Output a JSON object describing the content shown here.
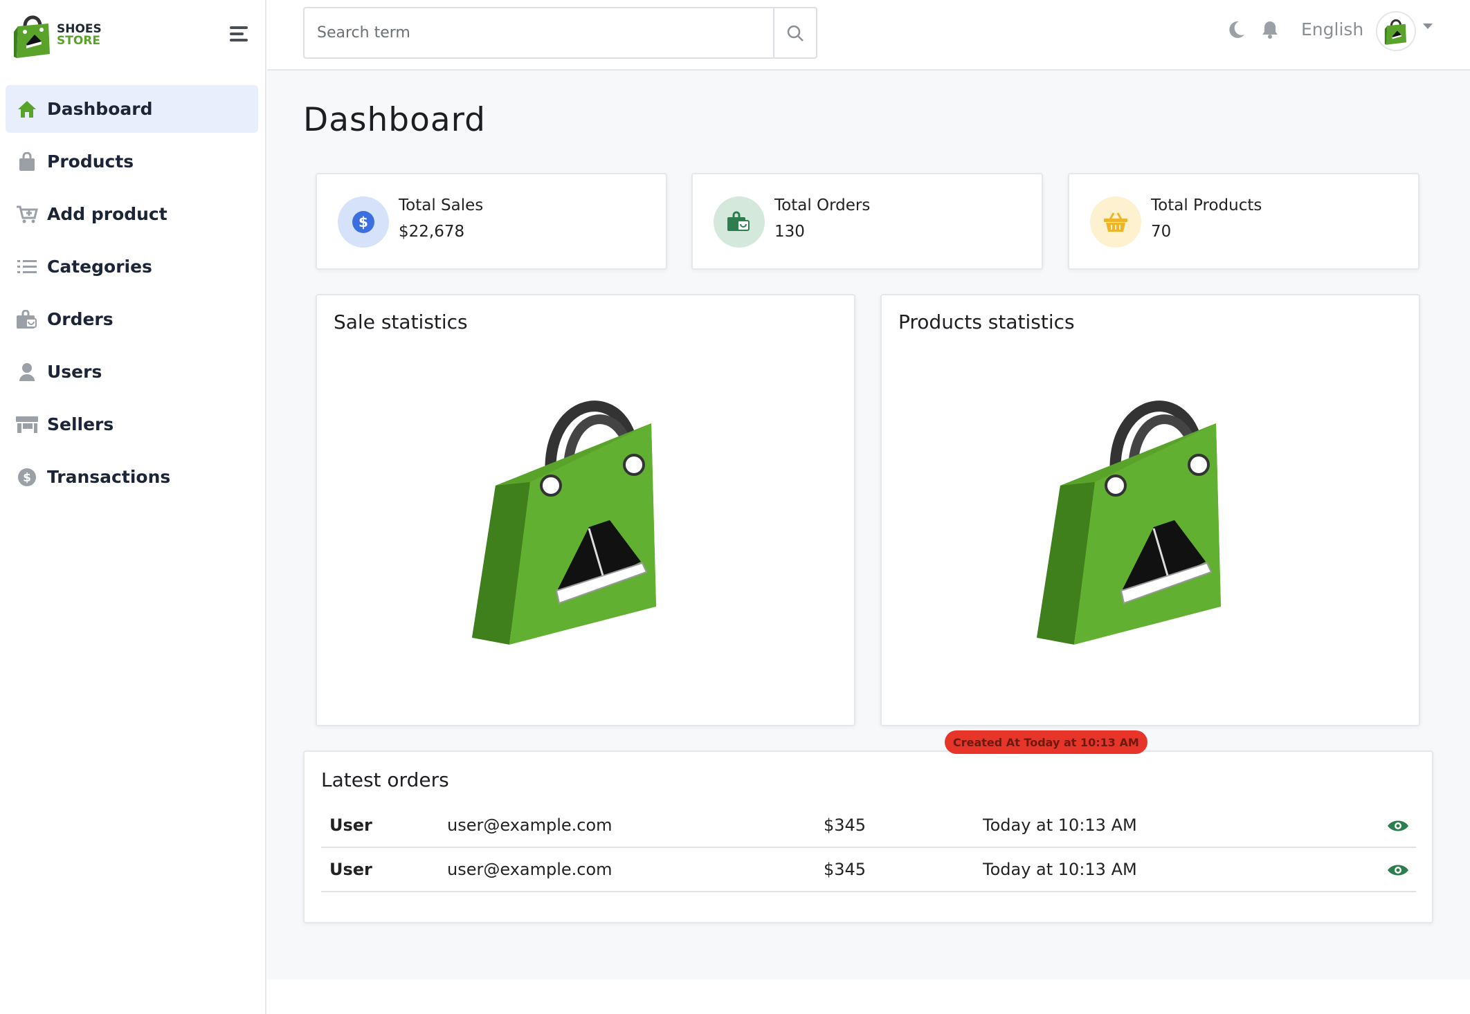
{
  "brand": {
    "line1": "SHOES",
    "line2": "STORE"
  },
  "sidebar": {
    "items": [
      {
        "label": "Dashboard",
        "icon": "home-icon",
        "active": true
      },
      {
        "label": "Products",
        "icon": "bag-icon"
      },
      {
        "label": "Add product",
        "icon": "cart-plus-icon"
      },
      {
        "label": "Categories",
        "icon": "list-icon"
      },
      {
        "label": "Orders",
        "icon": "shopping-bag-icon"
      },
      {
        "label": "Users",
        "icon": "user-icon"
      },
      {
        "label": "Sellers",
        "icon": "store-icon"
      },
      {
        "label": "Transactions",
        "icon": "dollar-circle-icon"
      }
    ]
  },
  "header": {
    "search_placeholder": "Search term",
    "language": "English"
  },
  "page": {
    "title": "Dashboard"
  },
  "stats": [
    {
      "title": "Total Sales",
      "value": "$22,678",
      "icon": "dollar-icon",
      "color": "#3b6fe0",
      "bg": "#d6e2fa"
    },
    {
      "title": "Total Orders",
      "value": "130",
      "icon": "shopping-bag-icon",
      "color": "#2e7d4f",
      "bg": "#d4e8dc"
    },
    {
      "title": "Total Products",
      "value": "70",
      "icon": "basket-icon",
      "color": "#f0b429",
      "bg": "#fdf1cf"
    }
  ],
  "charts": {
    "sales_title": "Sale statistics",
    "products_title": "Products statistics"
  },
  "tooltip": "Created At Today at 10:13 AM",
  "orders": {
    "title": "Latest orders",
    "rows": [
      {
        "name": "User",
        "email": "user@example.com",
        "amount": "$345",
        "date": "Today at 10:13 AM"
      },
      {
        "name": "User",
        "email": "user@example.com",
        "amount": "$345",
        "date": "Today at 10:13 AM"
      }
    ]
  },
  "colors": {
    "accent": "#5aa32b",
    "active_bg": "#e8eefc",
    "badge": "#e8352a",
    "eye": "#2e7d4f"
  }
}
